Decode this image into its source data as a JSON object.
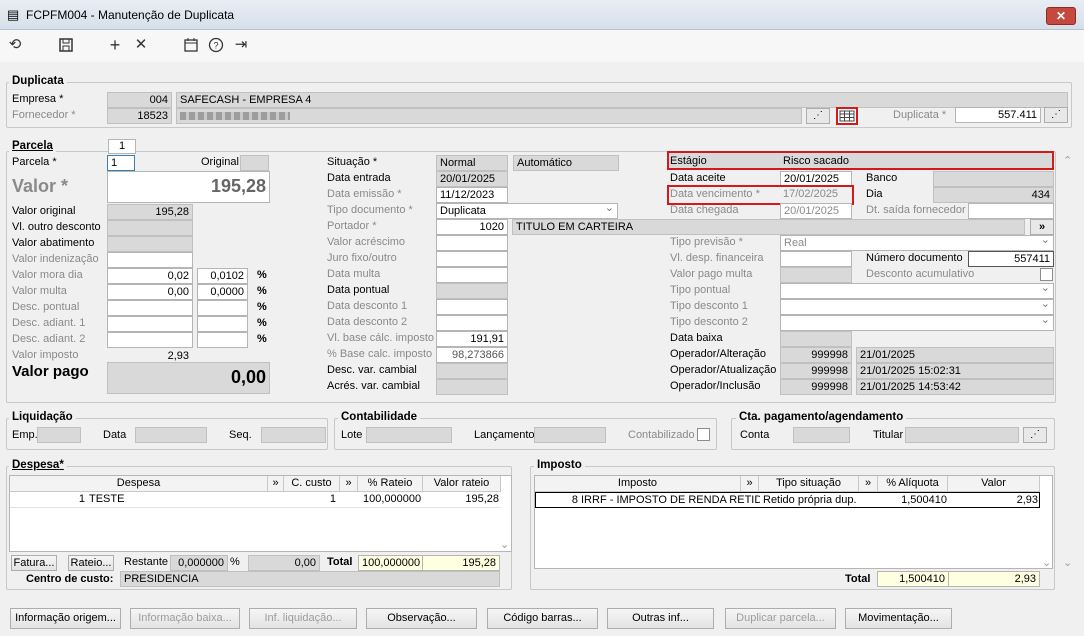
{
  "window": {
    "title": "FCPFM004 - Manutenção de Duplicata",
    "close": "✕"
  },
  "toolbar": {
    "icons": [
      "undo-icon",
      "save-icon",
      "add-icon",
      "delete-icon",
      "calendar-icon",
      "help-icon",
      "exit-icon"
    ]
  },
  "duplicata": {
    "group": "Duplicata",
    "empresa_label": "Empresa *",
    "empresa_code": "004",
    "empresa_name": "SAFECASH - EMPRESA 4",
    "fornecedor_label": "Fornecedor *",
    "fornecedor_code": "18523",
    "duplicata_label": "Duplicata *",
    "duplicata_value": "557.411"
  },
  "parcela": {
    "tab": "Parcela",
    "tab_num": "1",
    "parcela_label": "Parcela *",
    "parcela_value": "1",
    "original_label": "Original",
    "valor_label": "Valor *",
    "valor_value": "195,28",
    "rows": [
      {
        "label": "Valor original",
        "v1": "195,28",
        "bold": true
      },
      {
        "label": "Vl. outro desconto",
        "v1": "",
        "bold": true
      },
      {
        "label": "Valor abatimento",
        "v1": "",
        "bold": true
      },
      {
        "label": "Valor indenização",
        "v1": "",
        "bold": false
      },
      {
        "label": "Valor mora dia",
        "v1": "0,02",
        "v2": "0,0102",
        "pct": "%",
        "bold": false
      },
      {
        "label": "Valor multa",
        "v1": "0,00",
        "v2": "0,0000",
        "pct": "%",
        "bold": false
      },
      {
        "label": "Desc. pontual",
        "v1": "",
        "v2": "",
        "pct": "%",
        "bold": false
      },
      {
        "label": "Desc. adiant. 1",
        "v1": "",
        "v2": "",
        "pct": "%",
        "bold": false
      },
      {
        "label": "Desc. adiant. 2",
        "v1": "",
        "v2": "",
        "pct": "%",
        "bold": false
      },
      {
        "label": "Valor imposto",
        "v1": "2,93",
        "bold": false
      }
    ],
    "valor_pago_label": "Valor pago",
    "valor_pago_value": "0,00"
  },
  "mid": {
    "rows": [
      {
        "label": "Situação *",
        "bold": false
      },
      {
        "label": "Data entrada",
        "bold": true
      },
      {
        "label": "Data emissão *",
        "bold": false
      },
      {
        "label": "Tipo documento *",
        "bold": false
      },
      {
        "label": "Portador *",
        "bold": false
      },
      {
        "label": "Valor acréscimo",
        "bold": false
      },
      {
        "label": "Juro fixo/outro",
        "bold": false
      },
      {
        "label": "Data multa",
        "bold": false
      },
      {
        "label": "Data pontual",
        "bold": true
      },
      {
        "label": "Data desconto 1",
        "bold": false
      },
      {
        "label": "Data desconto 2",
        "bold": false
      },
      {
        "label": "Vl. base cálc. imposto",
        "bold": false
      },
      {
        "label": "% Base calc. imposto",
        "bold": false
      },
      {
        "label": "Desc. var. cambial",
        "bold": true
      },
      {
        "label": "Acrés. var. cambial",
        "bold": true
      }
    ],
    "situacao": "Normal",
    "situacao2": "Automático",
    "data_entrada": "20/01/2025",
    "data_emissao": "11/12/2023",
    "tipo_documento": "Duplicata",
    "portador_code": "1020",
    "portador_name": "TITULO EM CARTEIRA",
    "vl_base": "191,91",
    "pct_base": "98,273866"
  },
  "right": {
    "estagio_label": "Estágio",
    "estagio_value": "Risco sacado",
    "data_aceite_label": "Data aceite",
    "data_aceite": "20/01/2025",
    "banco_label": "Banco",
    "data_venc_label": "Data vencimento *",
    "data_venc": "17/02/2025",
    "dia_label": "Dia",
    "dia_value": "434",
    "data_chegada_label": "Data chegada",
    "data_chegada": "20/01/2025",
    "dt_saida_label": "Dt. saída fornecedor",
    "tipo_previsao_label": "Tipo previsão *",
    "tipo_previsao": "Real",
    "vl_desp_label": "Vl. desp. financeira",
    "num_doc_label": "Número documento",
    "num_doc": "557411",
    "valor_pago_multa_label": "Valor pago multa",
    "desconto_acum_label": "Desconto acumulativo",
    "tipo_pontual_label": "Tipo pontual",
    "tipo_desc1_label": "Tipo desconto 1",
    "tipo_desc2_label": "Tipo desconto 2",
    "data_baixa_label": "Data baixa",
    "operadores": [
      {
        "label": "Operador/Alteração",
        "code": "999998",
        "date": "21/01/2025"
      },
      {
        "label": "Operador/Atualização",
        "code": "999998",
        "date": "21/01/2025 15:02:31"
      },
      {
        "label": "Operador/Inclusão",
        "code": "999998",
        "date": "21/01/2025 14:53:42"
      }
    ]
  },
  "liquidacao": {
    "title": "Liquidação",
    "emp": "Emp.",
    "data": "Data",
    "seq": "Seq."
  },
  "contabilidade": {
    "title": "Contabilidade",
    "lote": "Lote",
    "lancamento": "Lançamento",
    "contabilizado": "Contabilizado"
  },
  "cta": {
    "title": "Cta. pagamento/agendamento",
    "conta": "Conta",
    "titular": "Titular"
  },
  "despesa": {
    "title": "Despesa",
    "req": "*",
    "headers": [
      "Despesa",
      "»",
      "C. custo",
      "»",
      "% Rateio",
      "Valor rateio"
    ],
    "rows": [
      {
        "num": "1",
        "name": "TESTE",
        "ccusto": "1",
        "rateio": "100,000000",
        "valor": "195,28"
      }
    ],
    "btn_fatura": "Fatura...",
    "btn_rateio": "Rateio...",
    "restante_label": "Restante",
    "restante_value": "0,000000",
    "pct": "%",
    "restante_valor": "0,00",
    "total_label": "Total",
    "total_rateio": "100,000000",
    "total_valor": "195,28",
    "centro_label": "Centro de custo:",
    "centro_value": "PRESIDENCIA"
  },
  "imposto": {
    "title": "Imposto",
    "headers": [
      "Imposto",
      "»",
      "Tipo situação",
      "»",
      "% Alíquota",
      "Valor"
    ],
    "rows": [
      {
        "num": "8",
        "name": "IRRF - IMPOSTO DE RENDA RETIDO N",
        "tipo": "Retido própria dup.",
        "aliq": "1,500410",
        "valor": "2,93"
      }
    ],
    "total_label": "Total",
    "total_aliq": "1,500410",
    "total_valor": "2,93"
  },
  "buttons": [
    {
      "label": "Informação origem...",
      "enabled": true
    },
    {
      "label": "Informação baixa...",
      "enabled": false
    },
    {
      "label": "Inf. liquidação...",
      "enabled": false
    },
    {
      "label": "Observação...",
      "enabled": true
    },
    {
      "label": "Código barras...",
      "enabled": true
    },
    {
      "label": "Outras inf...",
      "enabled": true
    },
    {
      "label": "Duplicar parcela...",
      "enabled": false
    },
    {
      "label": "Movimentação...",
      "enabled": true
    }
  ]
}
